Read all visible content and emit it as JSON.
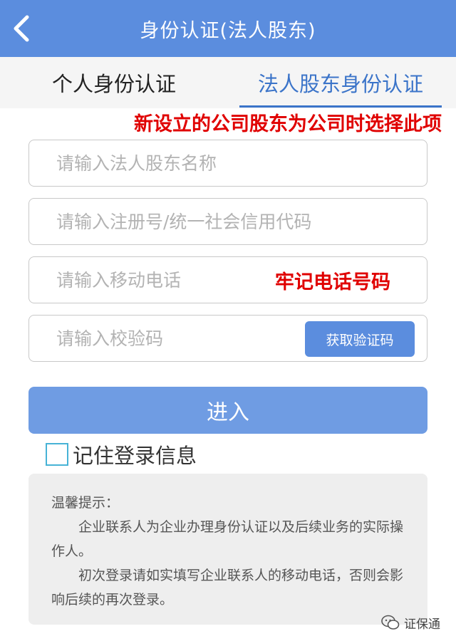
{
  "header": {
    "title": "身份认证(法人股东)",
    "back_icon": "chevron-left-icon"
  },
  "tabs": [
    {
      "label": "个人身份认证",
      "active": false
    },
    {
      "label": "法人股东身份认证",
      "active": true
    }
  ],
  "annotations": {
    "corporate_tip": "新设立的公司股东为公司时选择此项",
    "phone_tip": "牢记电话号码"
  },
  "form": {
    "company_name": {
      "value": "",
      "placeholder": "请输入法人股东名称"
    },
    "registration_no": {
      "value": "",
      "placeholder": "请输入注册号/统一社会信用代码"
    },
    "mobile": {
      "value": "",
      "placeholder": "请输入移动电话"
    },
    "verification_code": {
      "value": "",
      "placeholder": "请输入校验码"
    },
    "get_code_label": "获取验证码",
    "submit_label": "进入",
    "remember_label": "记住登录信息",
    "remember_checked": false
  },
  "tips": {
    "title": "温馨提示：",
    "line1": "企业联系人为企业办理身份认证以及后续业务的实际操作人。",
    "line2": "初次登录请如实填写企业联系人的移动电话，否则会影响后续的再次登录。"
  },
  "watermark": {
    "text": "证保通",
    "icon": "wechat-icon"
  },
  "colors": {
    "header_bg": "#5b8dde",
    "active_tab": "#3b74c9",
    "button": "#5b8dde",
    "submit": "#6f9ce3",
    "annotation": "#e00000",
    "tips_bg": "#eeeeee"
  }
}
